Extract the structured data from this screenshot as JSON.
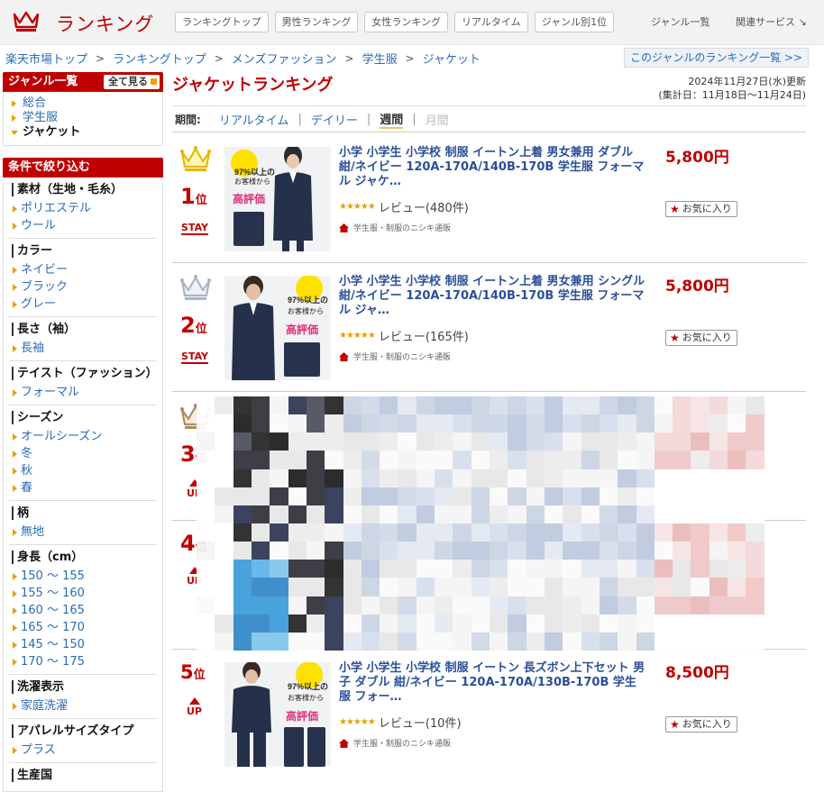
{
  "header": {
    "logo_text": "ランキング",
    "tabs": [
      "ランキングトップ",
      "男性ランキング",
      "女性ランキング",
      "リアルタイム",
      "ジャンル別1位"
    ],
    "genre_list": "ジャンル一覧",
    "related": "関連サービス ↘"
  },
  "breadcrumb": [
    "楽天市場トップ",
    "ランキングトップ",
    "メンズファッション",
    "学生服",
    "ジャケット"
  ],
  "breadcrumb_sep": ">",
  "genre_ranking_link": "このジャンルのランキング一覧 >>",
  "sidebar": {
    "genre_title": "ジャンル一覧",
    "all_button": "全て見る",
    "genres": [
      {
        "label": "総合",
        "current": false
      },
      {
        "label": "学生服",
        "current": false
      },
      {
        "label": "ジャケット",
        "current": true
      }
    ],
    "filter_title": "条件で絞り込む",
    "sections": [
      {
        "title": "素材（生地・毛糸）",
        "items": [
          "ポリエステル",
          "ウール"
        ]
      },
      {
        "title": "カラー",
        "items": [
          "ネイビー",
          "ブラック",
          "グレー"
        ]
      },
      {
        "title": "長さ（袖）",
        "items": [
          "長袖"
        ]
      },
      {
        "title": "テイスト（ファッション）",
        "items": [
          "フォーマル"
        ]
      },
      {
        "title": "シーズン",
        "items": [
          "オールシーズン",
          "冬",
          "秋",
          "春"
        ]
      },
      {
        "title": "柄",
        "items": [
          "無地"
        ]
      },
      {
        "title": "身長（cm）",
        "items": [
          "150 ～ 155",
          "155 ～ 160",
          "160 ～ 165",
          "165 ～ 170",
          "145 ～ 150",
          "170 ～ 175"
        ]
      },
      {
        "title": "洗濯表示",
        "items": [
          "家庭洗濯"
        ]
      },
      {
        "title": "アパレルサイズタイプ",
        "items": [
          "プラス"
        ]
      },
      {
        "title": "生産国",
        "items": []
      }
    ]
  },
  "main": {
    "title": "ジャケットランキング",
    "updated": "2024年11月27日(水)更新",
    "period_range": "(集計日：11月18日～11月24日)",
    "period_label": "期間:",
    "periods": [
      "リアルタイム",
      "デイリー",
      "週間",
      "月間"
    ],
    "period_sep": "|",
    "rank_suffix": "位",
    "items": [
      {
        "rank": "1",
        "status": "STAY",
        "title": "小学 小学生 小学校 制服 イートン上着 男女兼用 ダブル 紺/ネイビー 120A-170A/140B-170B 学生服 フォーマル ジャケ…",
        "rating": "★★★★★",
        "reviews": "レビュー(480件)",
        "shop": "学生服・制服のニシキ通販",
        "price": "5,800円",
        "fav": "お気に入り",
        "crown": "gold"
      },
      {
        "rank": "2",
        "status": "STAY",
        "title": "小学 小学生 小学校 制服 イートン上着 男女兼用 シングル 紺/ネイビー 120A-170A/140B-170B 学生服 フォーマル ジャ…",
        "rating": "★★★★★",
        "reviews": "レビュー(165件)",
        "shop": "学生服・制服のニシキ通販",
        "price": "5,800円",
        "fav": "お気に入り",
        "crown": "silver"
      },
      {
        "rank": "3",
        "status": "UP",
        "crown": "bronze"
      },
      {
        "rank": "4",
        "status": "UP"
      },
      {
        "rank": "5",
        "status": "UP",
        "title": "小学 小学生 小学校 制服 イートン 長ズボン上下セット 男子 ダブル 紺/ネイビー 120A-170A/130B-170B 学生服 フォー…",
        "rating": "★★★★★",
        "reviews": "レビュー(10件)",
        "shop": "学生服・制服のニシキ通販",
        "price": "8,500円",
        "fav": "お気に入り"
      }
    ],
    "promo": {
      "line1": "97%以上の",
      "line2": "お客様から",
      "line3": "高評価"
    }
  },
  "colors": {
    "accent": "#bf0000",
    "link": "#2a6bb6",
    "star": "#e8a000"
  }
}
